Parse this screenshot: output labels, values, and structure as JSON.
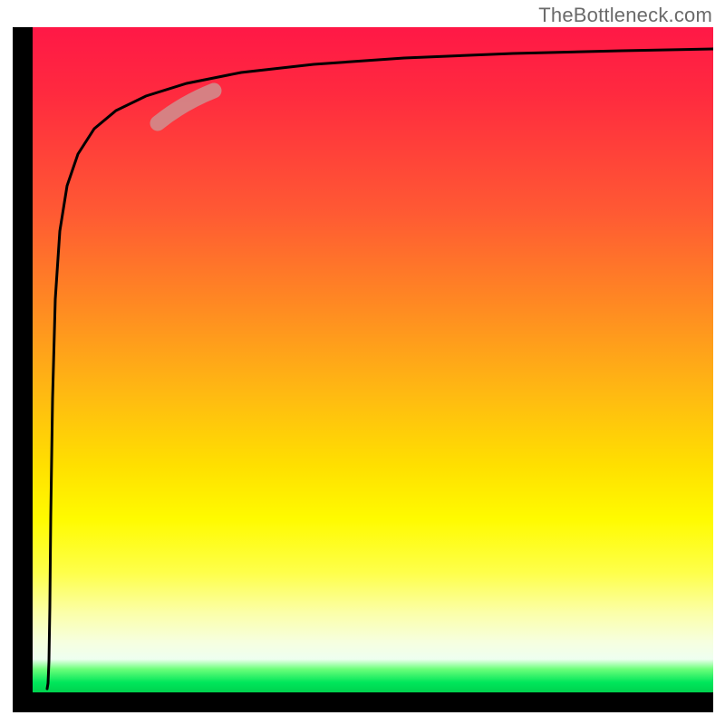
{
  "watermark": "TheBottleneck.com",
  "chart_data": {
    "type": "line",
    "title": "",
    "xlabel": "",
    "ylabel": "",
    "xlim": [
      0,
      100
    ],
    "ylim": [
      0,
      100
    ],
    "grid": false,
    "legend": false,
    "background_gradient": [
      "#ff1846",
      "#ff8a22",
      "#fffb00",
      "#f6ffe0",
      "#00d24e"
    ],
    "annotations": [
      {
        "type": "highlight_segment",
        "x_range": [
          18,
          27
        ],
        "color": "#cf8f8f"
      }
    ],
    "series": [
      {
        "name": "curve",
        "color": "#000000",
        "x": [
          2.5,
          2.7,
          3.0,
          3.1,
          3.3,
          3.6,
          4.1,
          5.0,
          6.5,
          9.0,
          12.0,
          16.0,
          22.0,
          30.0,
          40.0,
          55.0,
          75.0,
          100.0
        ],
        "y": [
          0.0,
          1.0,
          6.0,
          20.0,
          40.0,
          58.0,
          70.0,
          78.0,
          83.0,
          86.5,
          89.0,
          90.8,
          92.1,
          93.2,
          94.0,
          94.8,
          95.6,
          96.3
        ]
      }
    ]
  }
}
